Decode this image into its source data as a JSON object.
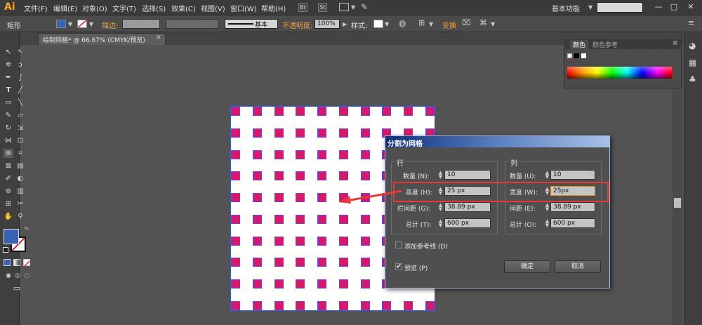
{
  "app": {
    "logo": "Ai",
    "menus": [
      "文件(F)",
      "编辑(E)",
      "对象(O)",
      "文字(T)",
      "选择(S)",
      "效果(C)",
      "视图(V)",
      "窗口(W)",
      "帮助(H)"
    ],
    "badge_br": "Br",
    "badge_st": "St",
    "workspace": "基本功能",
    "window_buttons": [
      "—",
      "□",
      "✕"
    ]
  },
  "control_bar": {
    "object_type": "矩形",
    "stroke_label": "描边:",
    "stroke_style": "基本",
    "opacity_label": "不透明度:",
    "opacity_value": "100%",
    "style_label": "样式:",
    "transform_label": "变换",
    "fill_color": "#3b63b4"
  },
  "document": {
    "tab_title": "绘制网格* @ 66.67% (CMYK/预览)",
    "close": "✕"
  },
  "color_panel": {
    "tabs": [
      "颜色",
      "颜色参考"
    ]
  },
  "dialog": {
    "title": "分割为网格",
    "rows_group": "行",
    "cols_group": "列",
    "rows": {
      "count_label": "数量 (N):",
      "count_value": "10",
      "height_label": "高度 (H):",
      "height_value": "25 px",
      "gutter_label": "栏间距 (G):",
      "gutter_value": "38.89 px",
      "total_label": "总计 (T):",
      "total_value": "600 px"
    },
    "cols": {
      "count_label": "数量 (U):",
      "count_value": "10",
      "width_label": "宽度 (W):",
      "width_value": "25px",
      "gutter_label": "间距 (E):",
      "gutter_value": "38.89 px",
      "total_label": "总计 (O):",
      "total_value": "600 px"
    },
    "add_guides_label": "添加参考线 (D)",
    "add_guides_checked": false,
    "preview_label": "预览 (P)",
    "preview_checked": true,
    "ok_label": "确定",
    "cancel_label": "取消"
  },
  "grid": {
    "rows": 10,
    "cols": 10,
    "cell_color": "#d8186d"
  },
  "annotation": {
    "highlight_color": "#e53a3a"
  }
}
